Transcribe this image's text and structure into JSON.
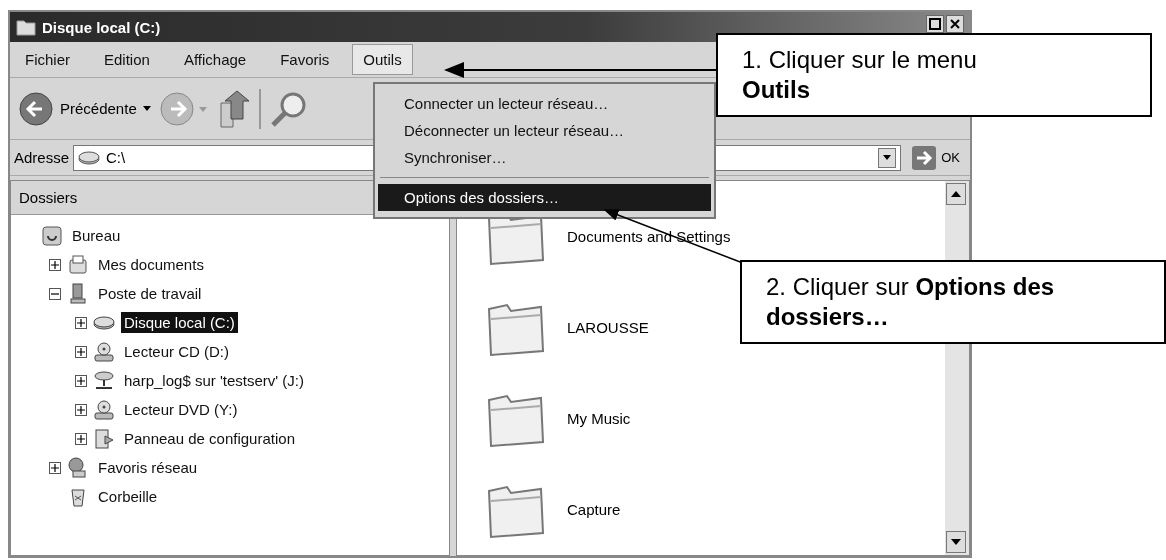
{
  "window": {
    "title": "Disque local (C:)"
  },
  "menu_bar": [
    {
      "label": "Fichier",
      "selected": false
    },
    {
      "label": "Edition",
      "selected": false
    },
    {
      "label": "Affichage",
      "selected": false
    },
    {
      "label": "Favoris",
      "selected": false
    },
    {
      "label": "Outils",
      "selected": true
    }
  ],
  "dropdown": [
    {
      "kind": "item",
      "label": "Connecter un lecteur réseau…",
      "selected": false
    },
    {
      "kind": "item",
      "label": "Déconnecter un lecteur réseau…",
      "selected": false
    },
    {
      "kind": "item",
      "label": "Synchroniser…",
      "selected": false
    },
    {
      "kind": "separator"
    },
    {
      "kind": "item",
      "label": "Options des dossiers…",
      "selected": true
    }
  ],
  "toolbar": {
    "back_label": "Précédente"
  },
  "address_bar": {
    "label": "Adresse",
    "value": "C:\\",
    "go_label": "OK"
  },
  "folders_pane": {
    "title": "Dossiers",
    "tree": [
      {
        "kind": "desktop",
        "label": "Bureau",
        "selected": false,
        "children": [
          {
            "kind": "documents",
            "label": "Mes documents",
            "expanded": false,
            "selected": false
          },
          {
            "kind": "computer",
            "label": "Poste de travail",
            "expanded": true,
            "selected": false,
            "children": [
              {
                "kind": "drive",
                "label": "Disque local (C:)",
                "expanded": false,
                "selected": true
              },
              {
                "kind": "cd",
                "label": "Lecteur CD (D:)",
                "expanded": false,
                "selected": false
              },
              {
                "kind": "network-drive",
                "label": "harp_log$ sur 'testserv' (J:)",
                "expanded": false,
                "selected": false
              },
              {
                "kind": "cd",
                "label": "Lecteur DVD (Y:)",
                "expanded": false,
                "selected": false
              },
              {
                "kind": "control-panel",
                "label": "Panneau de configuration",
                "expanded": false,
                "selected": false
              }
            ]
          },
          {
            "kind": "network",
            "label": "Favoris réseau",
            "expanded": false,
            "selected": false
          },
          {
            "kind": "recycle-bin",
            "label": "Corbeille",
            "selected": false
          }
        ]
      }
    ]
  },
  "files": [
    {
      "name": "Documents and Settings"
    },
    {
      "name": "LAROUSSE"
    },
    {
      "name": "My Music"
    },
    {
      "name": "Capture"
    }
  ],
  "callouts": [
    {
      "text": "1. Cliquer sur le menu **Outils**"
    },
    {
      "text": "2. Cliquer sur **Options des dossiers…**"
    }
  ]
}
